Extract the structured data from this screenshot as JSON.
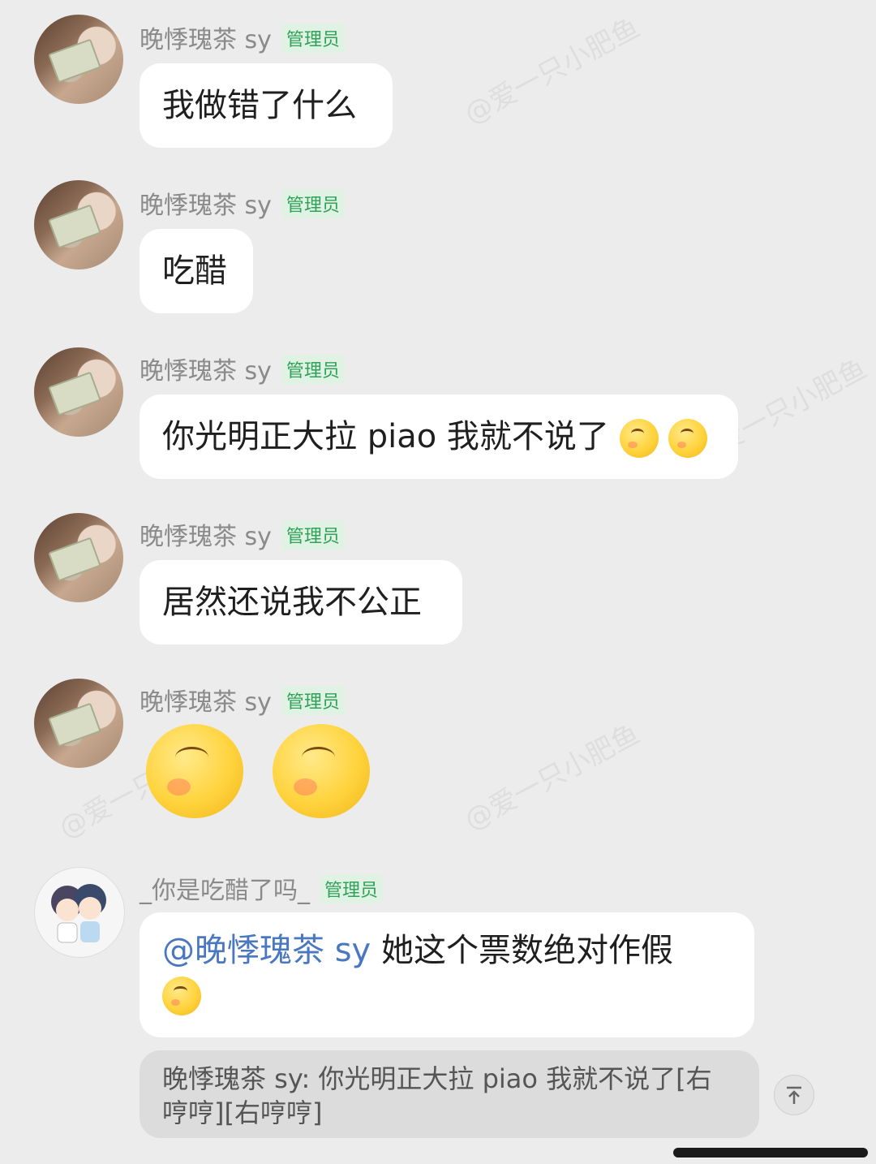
{
  "admin_badge": "管理员",
  "messages": [
    {
      "sender": "晚悸瑰茶 sy",
      "text": "我做错了什么"
    },
    {
      "sender": "晚悸瑰茶 sy",
      "text": "吃醋"
    },
    {
      "sender": "晚悸瑰茶 sy",
      "text": "你光明正大拉 piao 我就不说了",
      "emoji": "右哼哼"
    },
    {
      "sender": "晚悸瑰茶 sy",
      "text": "居然还说我不公正"
    },
    {
      "sender": "晚悸瑰茶 sy",
      "sticker": "右哼哼"
    },
    {
      "sender": "_你是吃醋了吗_",
      "mention": "@晚悸瑰茶 sy",
      "text": "她这个票数绝对作假"
    }
  ],
  "quote": "晚悸瑰茶 sy: 你光明正大拉 piao 我就不说了[右哼哼][右哼哼]",
  "watermark": "@爱一只小肥鱼",
  "icons": {
    "scroll_top": "arrow-up-to-top-icon"
  }
}
